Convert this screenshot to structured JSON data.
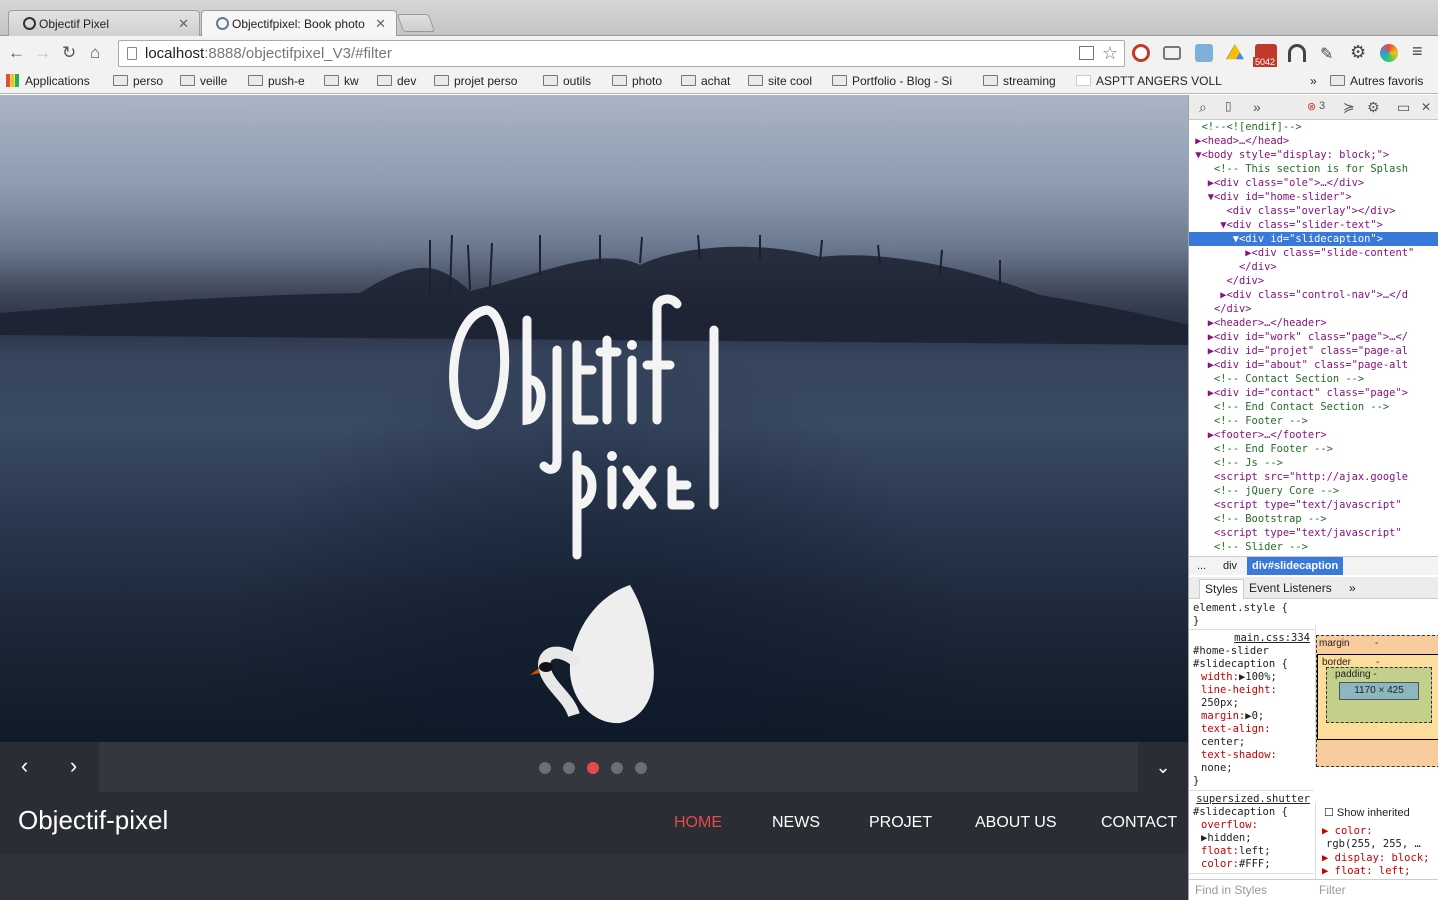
{
  "tabs": [
    {
      "title": "Objectif Pixel",
      "active": false
    },
    {
      "title": "Objectifpixel: Book photo",
      "active": true
    }
  ],
  "toolbar": {
    "back": "←",
    "forward": "→",
    "reload": "↻",
    "home": "⌂",
    "url_host": "localhost",
    "url_rest": ":8888/objectifpixel_V3/#filter",
    "star": "☆",
    "gmail_badge": "5042",
    "error_badge": "3"
  },
  "bookmarks": [
    "Applications",
    "perso",
    "veille",
    "push-e",
    "kw",
    "dev",
    "projet perso",
    "outils",
    "photo",
    "achat",
    "site cool",
    "Portfolio - Blog - Si",
    "streaming",
    "ASPTT ANGERS VOLL",
    "»",
    "Autres favoris"
  ],
  "slider": {
    "prev": "‹",
    "next": "›",
    "down": "⌄",
    "dots": 5,
    "active_dot": 3
  },
  "site": {
    "brand": "Objectif-pixel",
    "nav": [
      {
        "label": "HOME",
        "active": true
      },
      {
        "label": "NEWS",
        "active": false
      },
      {
        "label": "PROJET",
        "active": false
      },
      {
        "label": "ABOUT US",
        "active": false
      },
      {
        "label": "CONTACT",
        "active": false
      }
    ],
    "logo_line1": "Objectif",
    "logo_line2": "pixel"
  },
  "devtools": {
    "dom_lines": [
      "  <!--<![endif]-->",
      " ▶<head>…</head>",
      " ▼<body style=\"display: block;\">",
      "    <!-- This section is for Splash",
      "   ▶<div class=\"ole\">…</div>",
      "   ▼<div id=\"home-slider\">",
      "      <div class=\"overlay\"></div>",
      "     ▼<div class=\"slider-text\">",
      "       ▼<div id=\"slidecaption\">",
      "         ▶<div class=\"slide-content\"",
      "        </div>",
      "      </div>",
      "     ▶<div class=\"control-nav\">…</d",
      "    </div>",
      "   ▶<header>…</header>",
      "   ▶<div id=\"work\" class=\"page\">…</",
      "   ▶<div id=\"projet\" class=\"page-al",
      "   ▶<div id=\"about\" class=\"page-alt",
      "    <!-- Contact Section -->",
      "   ▶<div id=\"contact\" class=\"page\">",
      "    <!-- End Contact Section -->",
      "    <!-- Footer -->",
      "   ▶<footer>…</footer>",
      "    <!-- End Footer -->",
      "    <!-- Js -->",
      "    <script src=\"http://ajax.google",
      "    <!-- jQuery Core -->",
      "    <script type=\"text/javascript\"",
      "    <!-- Bootstrap -->",
      "    <script type=\"text/javascript\"",
      "    <!-- Slider -->",
      "    <script type=\"text/javascript\""
    ],
    "selected_line": 8,
    "crumbs": [
      "...",
      "div",
      "div#slidecaption"
    ],
    "panel_tabs": [
      "Styles",
      "Event Listeners",
      "»"
    ],
    "element_style": "element.style {",
    "rule1_src": "main.css:334",
    "rule1_sel": "#home-slider #slidecaption {",
    "rule1_props": [
      [
        "width:",
        "▶100%;"
      ],
      [
        "line-height:",
        "250px;"
      ],
      [
        "margin:",
        "▶0;"
      ],
      [
        "text-align:",
        "center;"
      ],
      [
        "text-shadow:",
        "none;"
      ]
    ],
    "rule2_src": "supersized.shutter",
    "rule2_sel": "#slidecaption {",
    "rule2_props": [
      [
        "overflow:",
        "▶hidden;"
      ],
      [
        "float:",
        "left;"
      ],
      [
        "color:",
        "#FFF;"
      ]
    ],
    "box": {
      "margin": "margin",
      "border": "border",
      "padding": "padding -",
      "content": "1170 × 425",
      "dash": "-"
    },
    "show_inherited": "Show inherited",
    "computed": [
      "▶ color:",
      "rgb(255, 255, …",
      "▶ display: block;",
      "▶ float: left;"
    ],
    "find_placeholder": "Find in Styles",
    "filter_placeholder": "Filter"
  }
}
